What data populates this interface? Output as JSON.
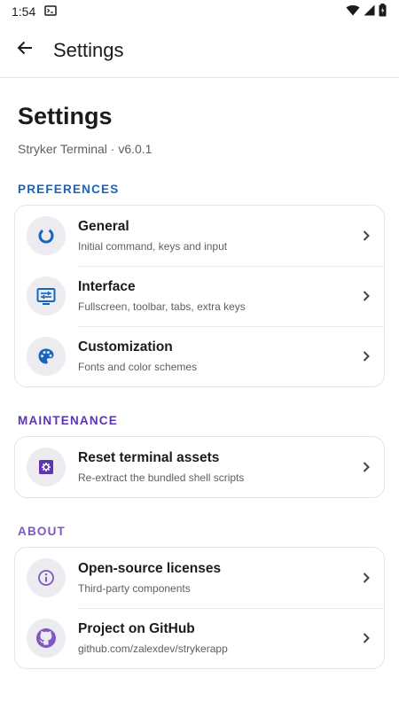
{
  "status_bar": {
    "time": "1:54"
  },
  "app_bar": {
    "title": "Settings",
    "back_icon": "arrow-back-icon"
  },
  "header": {
    "title": "Settings",
    "subtitle": "Stryker Terminal · v6.0.1"
  },
  "colors": {
    "preferences": "#1565c0",
    "maintenance": "#5e35b1",
    "about": "#7e57c2"
  },
  "sections": [
    {
      "header": "PREFERENCES",
      "items": [
        {
          "title": "General",
          "subtitle": "Initial command, keys and input",
          "icon": "donut-icon"
        },
        {
          "title": "Interface",
          "subtitle": "Fullscreen, toolbar, tabs, extra keys",
          "icon": "toolbar-icon"
        },
        {
          "title": "Customization",
          "subtitle": "Fonts and color schemes",
          "icon": "palette-icon"
        }
      ]
    },
    {
      "header": "MAINTENANCE",
      "items": [
        {
          "title": "Reset terminal assets",
          "subtitle": "Re-extract the bundled shell scripts",
          "icon": "settings-square-icon"
        }
      ]
    },
    {
      "header": "ABOUT",
      "items": [
        {
          "title": "Open-source licenses",
          "subtitle": "Third-party components",
          "icon": "info-icon"
        },
        {
          "title": "Project on GitHub",
          "subtitle": "github.com/zalexdev/strykerapp",
          "icon": "github-icon"
        }
      ]
    }
  ]
}
